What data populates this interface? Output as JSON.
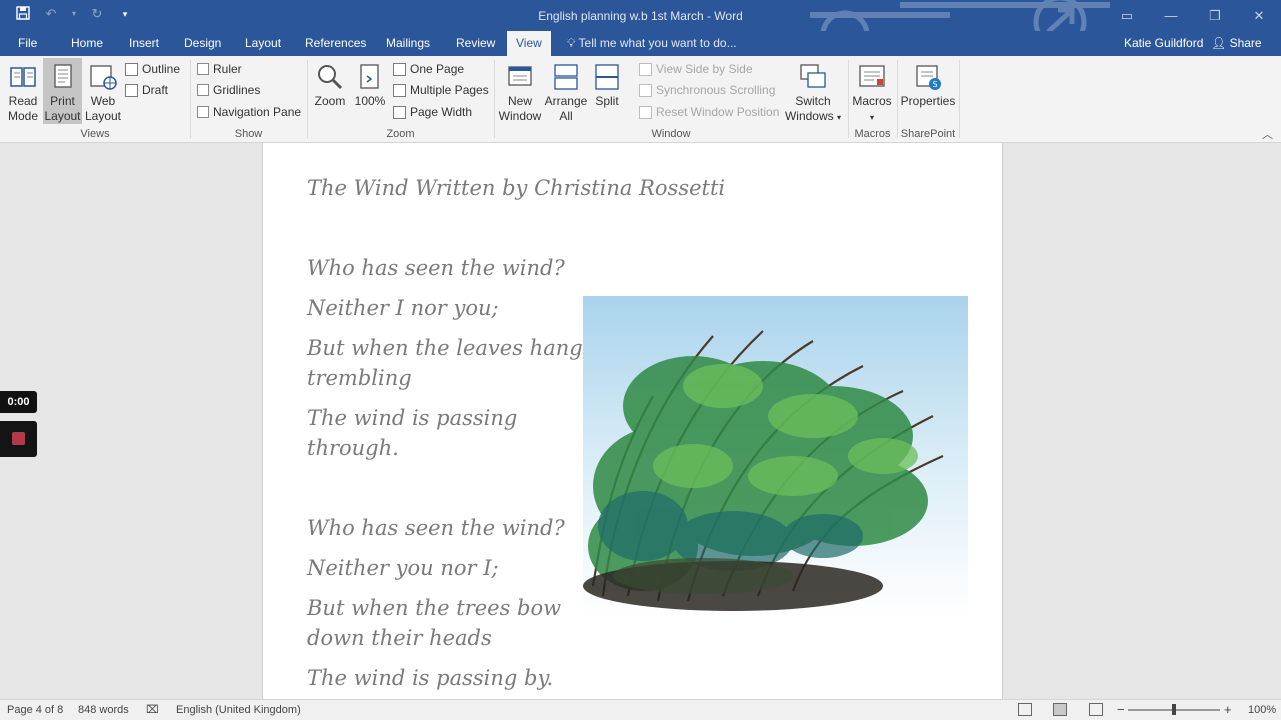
{
  "titlebar": {
    "title": "English planning w.b 1st March - Word",
    "qat": {
      "save_icon": "save-icon",
      "undo_icon": "undo-icon",
      "redo_icon": "redo-icon",
      "customize_icon": "customize-qat-icon"
    },
    "window_controls": {
      "restore_ribbon": "ribbon-display-icon",
      "minimize": "minimize-icon",
      "maximize": "maximize-icon",
      "close": "close-icon"
    }
  },
  "tabs": [
    {
      "label": "File"
    },
    {
      "label": "Home"
    },
    {
      "label": "Insert"
    },
    {
      "label": "Design"
    },
    {
      "label": "Layout"
    },
    {
      "label": "References"
    },
    {
      "label": "Mailings"
    },
    {
      "label": "Review"
    },
    {
      "label": "View",
      "active": true
    }
  ],
  "tell_me": {
    "placeholder": "Tell me what you want to do..."
  },
  "user": {
    "name": "Katie Guildford"
  },
  "share": {
    "label": "Share"
  },
  "ribbon": {
    "views": {
      "group_label": "Views",
      "read_mode": "Read Mode",
      "print_layout": "Print Layout",
      "web_layout": "Web Layout",
      "outline": "Outline",
      "draft": "Draft"
    },
    "show": {
      "group_label": "Show",
      "ruler": "Ruler",
      "gridlines": "Gridlines",
      "navigation_pane": "Navigation Pane"
    },
    "zoom": {
      "group_label": "Zoom",
      "zoom": "Zoom",
      "hundred": "100%",
      "one_page": "One Page",
      "multiple_pages": "Multiple Pages",
      "page_width": "Page Width"
    },
    "window": {
      "group_label": "Window",
      "new_window": "New Window",
      "arrange_all": "Arrange All",
      "split": "Split",
      "view_side_by_side": "View Side by Side",
      "synchronous_scrolling": "Synchronous Scrolling",
      "reset_window_position": "Reset Window Position",
      "switch_windows": "Switch Windows"
    },
    "macros": {
      "group_label": "Macros",
      "macros": "Macros"
    },
    "sharepoint": {
      "group_label": "SharePoint",
      "properties": "Properties"
    }
  },
  "document": {
    "title": "The Wind Written by Christina Rossetti",
    "stanza1": [
      "Who has seen the wind?",
      "Neither I nor you;",
      "But when the leaves hang",
      "trembling",
      "The wind is passing",
      "through."
    ],
    "stanza2": [
      "Who has seen the wind?",
      "Neither you nor I;",
      "But when the trees bow",
      "down their heads",
      "The wind is passing by."
    ]
  },
  "recorder": {
    "time": "0:00"
  },
  "status": {
    "page": "Page 4 of 8",
    "words": "848 words",
    "language": "English (United Kingdom)",
    "zoom": "100%",
    "zoom_minus": "−",
    "zoom_plus": "+"
  },
  "colors": {
    "accent": "#2b579a",
    "ribbon_bg": "#f3f3f3",
    "poem_text": "#7a7a7a"
  }
}
